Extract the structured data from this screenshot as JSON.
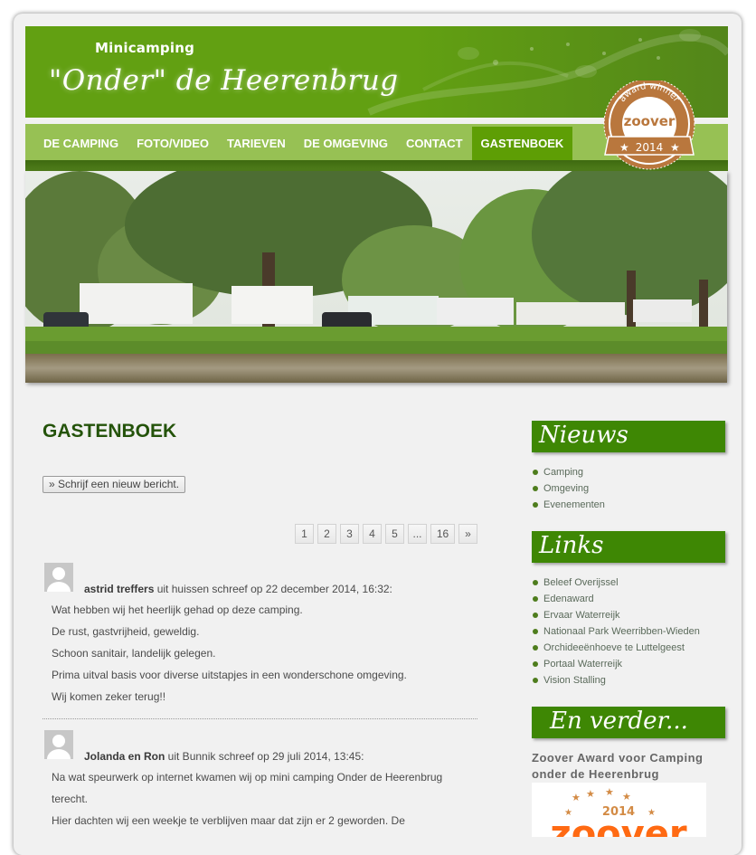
{
  "header": {
    "subtitle": "Minicamping",
    "title": "\"Onder\" de Heerenbrug"
  },
  "nav": {
    "items": [
      {
        "label": "DE CAMPING",
        "active": false
      },
      {
        "label": "FOTO/VIDEO",
        "active": false
      },
      {
        "label": "TARIEVEN",
        "active": false
      },
      {
        "label": "DE OMGEVING",
        "active": false
      },
      {
        "label": "CONTACT",
        "active": false
      },
      {
        "label": "GASTENBOEK",
        "active": true
      }
    ]
  },
  "badge": {
    "top_text": "award winner",
    "brand": "zoover",
    "year": "2014"
  },
  "main": {
    "title": "GASTENBOEK",
    "new_post_button": "» Schrijf een nieuw bericht.",
    "pagination": [
      "1",
      "2",
      "3",
      "4",
      "5",
      "...",
      "16",
      "»"
    ],
    "current_page": "1",
    "entries": [
      {
        "author": "astrid treffers",
        "meta": " uit huissen schreef op 22 december 2014, 16:32:",
        "lines": [
          "Wat hebben wij het heerlijk gehad op deze camping.",
          "De rust, gastvrijheid, geweldig.",
          "Schoon sanitair, landelijk gelegen.",
          "Prima uitval basis voor diverse uitstapjes in een wonderschone omgeving.",
          "Wij komen zeker terug!!"
        ]
      },
      {
        "author": "Jolanda en Ron",
        "meta": " uit Bunnik schreef op 29 juli 2014, 13:45:",
        "lines": [
          "Na wat speurwerk op internet kwamen wij op mini camping Onder de Heerenbrug",
          "terecht.",
          "Hier dachten wij een weekje te verblijven maar dat zijn er 2 geworden. De"
        ]
      }
    ]
  },
  "sidebar": {
    "news": {
      "title": "Nieuws",
      "items": [
        "Camping",
        "Omgeving",
        "Evenementen"
      ]
    },
    "links": {
      "title": "Links",
      "items": [
        "Beleef Overijssel",
        "Edenaward",
        "Ervaar Waterreijk",
        "Nationaal Park Weerribben-Wieden",
        "Orchideeënhoeve te Luttelgeest",
        "Portaal Waterreijk",
        "Vision Stalling"
      ]
    },
    "more": {
      "title": "En verder...",
      "award_title": "Zoover Award voor Camping onder de Heerenbrug",
      "award_year": "2014",
      "award_brand": "zoover"
    }
  },
  "colors": {
    "header_green": "#62a012",
    "nav_green": "#97c154",
    "nav_active": "#5e9e05",
    "title_green": "#24530a",
    "widget_green": "#3e8704",
    "badge_bronze": "#b9773d",
    "zoover_orange": "#ff6a13"
  }
}
